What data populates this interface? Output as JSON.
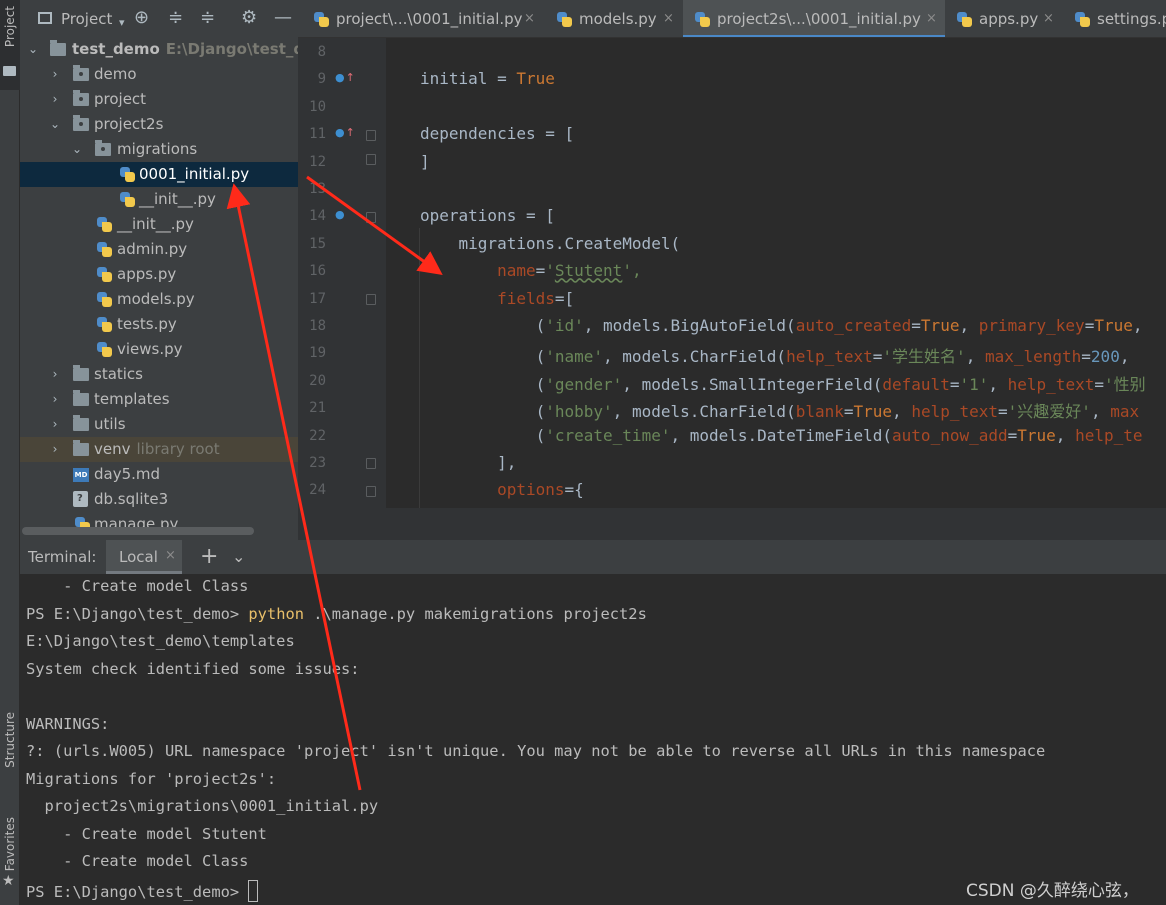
{
  "tool_strip": {
    "project": "Project",
    "structure": "Structure",
    "favorites": "Favorites"
  },
  "project_panel": {
    "title": "Project",
    "tree": [
      {
        "label": "test_demo",
        "sub": "E:\\Django\\test_demo"
      },
      {
        "label": "demo"
      },
      {
        "label": "project"
      },
      {
        "label": "project2s"
      },
      {
        "label": "migrations"
      },
      {
        "label": "0001_initial.py"
      },
      {
        "label": "__init__.py"
      },
      {
        "label": "__init__.py"
      },
      {
        "label": "admin.py"
      },
      {
        "label": "apps.py"
      },
      {
        "label": "models.py"
      },
      {
        "label": "tests.py"
      },
      {
        "label": "views.py"
      },
      {
        "label": "statics"
      },
      {
        "label": "templates"
      },
      {
        "label": "utils"
      },
      {
        "label": "venv",
        "sub": "library root"
      },
      {
        "label": "day5.md",
        "badge": "MD"
      },
      {
        "label": "db.sqlite3"
      },
      {
        "label": "manage.py"
      }
    ]
  },
  "editor_tabs": [
    {
      "label": "project\\...\\0001_initial.py",
      "close": "×"
    },
    {
      "label": "models.py",
      "close": "×"
    },
    {
      "label": "project2s\\...\\0001_initial.py",
      "close": "×"
    },
    {
      "label": "apps.py",
      "close": "×"
    },
    {
      "label": "settings.py"
    }
  ],
  "editor": {
    "line_numbers": [
      "8",
      "9",
      "10",
      "11",
      "12",
      "13",
      "14",
      "15",
      "16",
      "17",
      "18",
      "19",
      "20",
      "21",
      "22",
      "23",
      "24"
    ],
    "lines": [
      [],
      [
        [
          "initial = ",
          ""
        ],
        [
          "True",
          "kw"
        ]
      ],
      [],
      [
        [
          "dependencies = [",
          ""
        ]
      ],
      [
        [
          "]",
          ""
        ]
      ],
      [],
      [
        [
          "operations = [",
          ""
        ]
      ],
      [
        [
          "    migrations.CreateModel(",
          ""
        ]
      ],
      [
        [
          "        ",
          ""
        ],
        [
          "name",
          "prm"
        ],
        [
          "=",
          ""
        ],
        [
          "'",
          "str"
        ],
        [
          "Stutent",
          "str squig"
        ],
        [
          "',",
          "str"
        ]
      ],
      [
        [
          "        ",
          ""
        ],
        [
          "fields",
          "prm"
        ],
        [
          "=[",
          ""
        ]
      ],
      [
        [
          "            (",
          ""
        ],
        [
          "'id'",
          "str"
        ],
        [
          ", models.BigAutoField(",
          ""
        ],
        [
          "auto_created",
          "prm"
        ],
        [
          "=",
          ""
        ],
        [
          "True",
          "kw"
        ],
        [
          ", ",
          ""
        ],
        [
          "primary_key",
          "prm"
        ],
        [
          "=",
          ""
        ],
        [
          "True",
          "kw"
        ],
        [
          ",",
          ""
        ]
      ],
      [
        [
          "            (",
          ""
        ],
        [
          "'name'",
          "str"
        ],
        [
          ", models.CharField(",
          ""
        ],
        [
          "help_text",
          "prm"
        ],
        [
          "=",
          ""
        ],
        [
          "'学生姓名'",
          "str"
        ],
        [
          ", ",
          ""
        ],
        [
          "max_length",
          "prm"
        ],
        [
          "=",
          ""
        ],
        [
          "200",
          "num"
        ],
        [
          ",",
          ""
        ]
      ],
      [
        [
          "            (",
          ""
        ],
        [
          "'gender'",
          "str"
        ],
        [
          ", models.SmallIntegerField(",
          ""
        ],
        [
          "default",
          "prm"
        ],
        [
          "=",
          ""
        ],
        [
          "'1'",
          "str"
        ],
        [
          ", ",
          ""
        ],
        [
          "help_text",
          "prm"
        ],
        [
          "=",
          ""
        ],
        [
          "'性别",
          "str"
        ]
      ],
      [
        [
          "            (",
          ""
        ],
        [
          "'hobby'",
          "str"
        ],
        [
          ", models.CharField(",
          ""
        ],
        [
          "blank",
          "prm"
        ],
        [
          "=",
          ""
        ],
        [
          "True",
          "kw"
        ],
        [
          ", ",
          ""
        ],
        [
          "help_text",
          "prm"
        ],
        [
          "=",
          ""
        ],
        [
          "'兴趣爱好'",
          "str"
        ],
        [
          ", ",
          ""
        ],
        [
          "max",
          "prm"
        ]
      ],
      [
        [
          "            (",
          ""
        ],
        [
          "'create_time'",
          "str"
        ],
        [
          ", models.DateTimeField(",
          ""
        ],
        [
          "auto_now_add",
          "prm"
        ],
        [
          "=",
          ""
        ],
        [
          "True",
          "kw"
        ],
        [
          ", ",
          ""
        ],
        [
          "help_te",
          "prm"
        ]
      ],
      [
        [
          "        ],",
          ""
        ]
      ],
      [
        [
          "        ",
          ""
        ],
        [
          "options",
          "prm"
        ],
        [
          "={",
          ""
        ]
      ]
    ]
  },
  "terminal": {
    "title": "Terminal:",
    "tab_label": "Local",
    "tab_close": "×",
    "add": "+",
    "more": "⌄",
    "lines": [
      [
        [
          "    - Create model Class",
          ""
        ]
      ],
      [
        [
          "PS E:\\Django\\test_demo> ",
          ""
        ],
        [
          "python",
          "cmd"
        ],
        [
          " .\\manage.py makemigrations project2s",
          ""
        ]
      ],
      [
        [
          "E:\\Django\\test_demo\\templates",
          ""
        ]
      ],
      [
        [
          "System check identified some issues:",
          ""
        ]
      ],
      [
        [
          "",
          ""
        ]
      ],
      [
        [
          "WARNINGS:",
          ""
        ]
      ],
      [
        [
          "?: (urls.W005) URL namespace 'project' isn't unique. You may not be able to reverse all URLs in this namespace",
          ""
        ]
      ],
      [
        [
          "Migrations for 'project2s':",
          ""
        ]
      ],
      [
        [
          "  project2s\\migrations\\0001_initial.py",
          ""
        ]
      ],
      [
        [
          "    - Create model Stutent",
          ""
        ]
      ],
      [
        [
          "    - Create model Class",
          ""
        ]
      ],
      [
        [
          "PS E:\\Django\\test_demo> ",
          ""
        ]
      ]
    ],
    "watermark": "CSDN @久醉绕心弦，"
  }
}
